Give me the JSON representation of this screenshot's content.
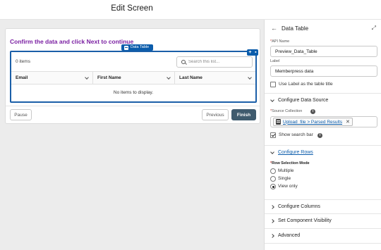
{
  "header": {
    "title": "Edit Screen"
  },
  "screen": {
    "heading": "Confirm the data and click Next to continue",
    "component_tag": "Data Table",
    "table": {
      "items_count": "0 items",
      "search_placeholder": "Search this list...",
      "columns": [
        {
          "label": "Email"
        },
        {
          "label": "First Name"
        },
        {
          "label": "Last Name"
        }
      ],
      "empty_message": "No items to display."
    },
    "buttons": {
      "pause": "Pause",
      "previous": "Previous",
      "finish": "Finish"
    }
  },
  "panel": {
    "title": "Data Table",
    "api_name": {
      "label": "API Name",
      "value": "Preview_Data_Table"
    },
    "label_field": {
      "label": "Label",
      "value": "Memberpress data"
    },
    "use_label_title": {
      "label": "Use Label as the table title",
      "checked": false
    },
    "configure_data_source": "Configure Data Source",
    "source_collection": {
      "label": "Source Collection",
      "value": "Upload_file > Parsed Results"
    },
    "show_search_bar": {
      "label": "Show search bar",
      "checked": true
    },
    "configure_rows": "Configure Rows",
    "row_selection_mode": {
      "label": "Row Selection Mode",
      "options": [
        "Multiple",
        "Single",
        "View only"
      ],
      "selected": "View only"
    },
    "configure_columns": "Configure Columns",
    "set_component_visibility": "Set Component Visibility",
    "advanced": "Advanced"
  },
  "colors": {
    "accent": "#0b5cab",
    "heading": "#7a1fa2",
    "finish_button": "#3f5b6e",
    "required": "#c23934"
  },
  "icons": [
    "search-icon",
    "chevron-down-icon",
    "back-arrow-icon",
    "expand-icon",
    "info-icon",
    "collection-icon",
    "close-icon",
    "chevron-right-icon"
  ]
}
